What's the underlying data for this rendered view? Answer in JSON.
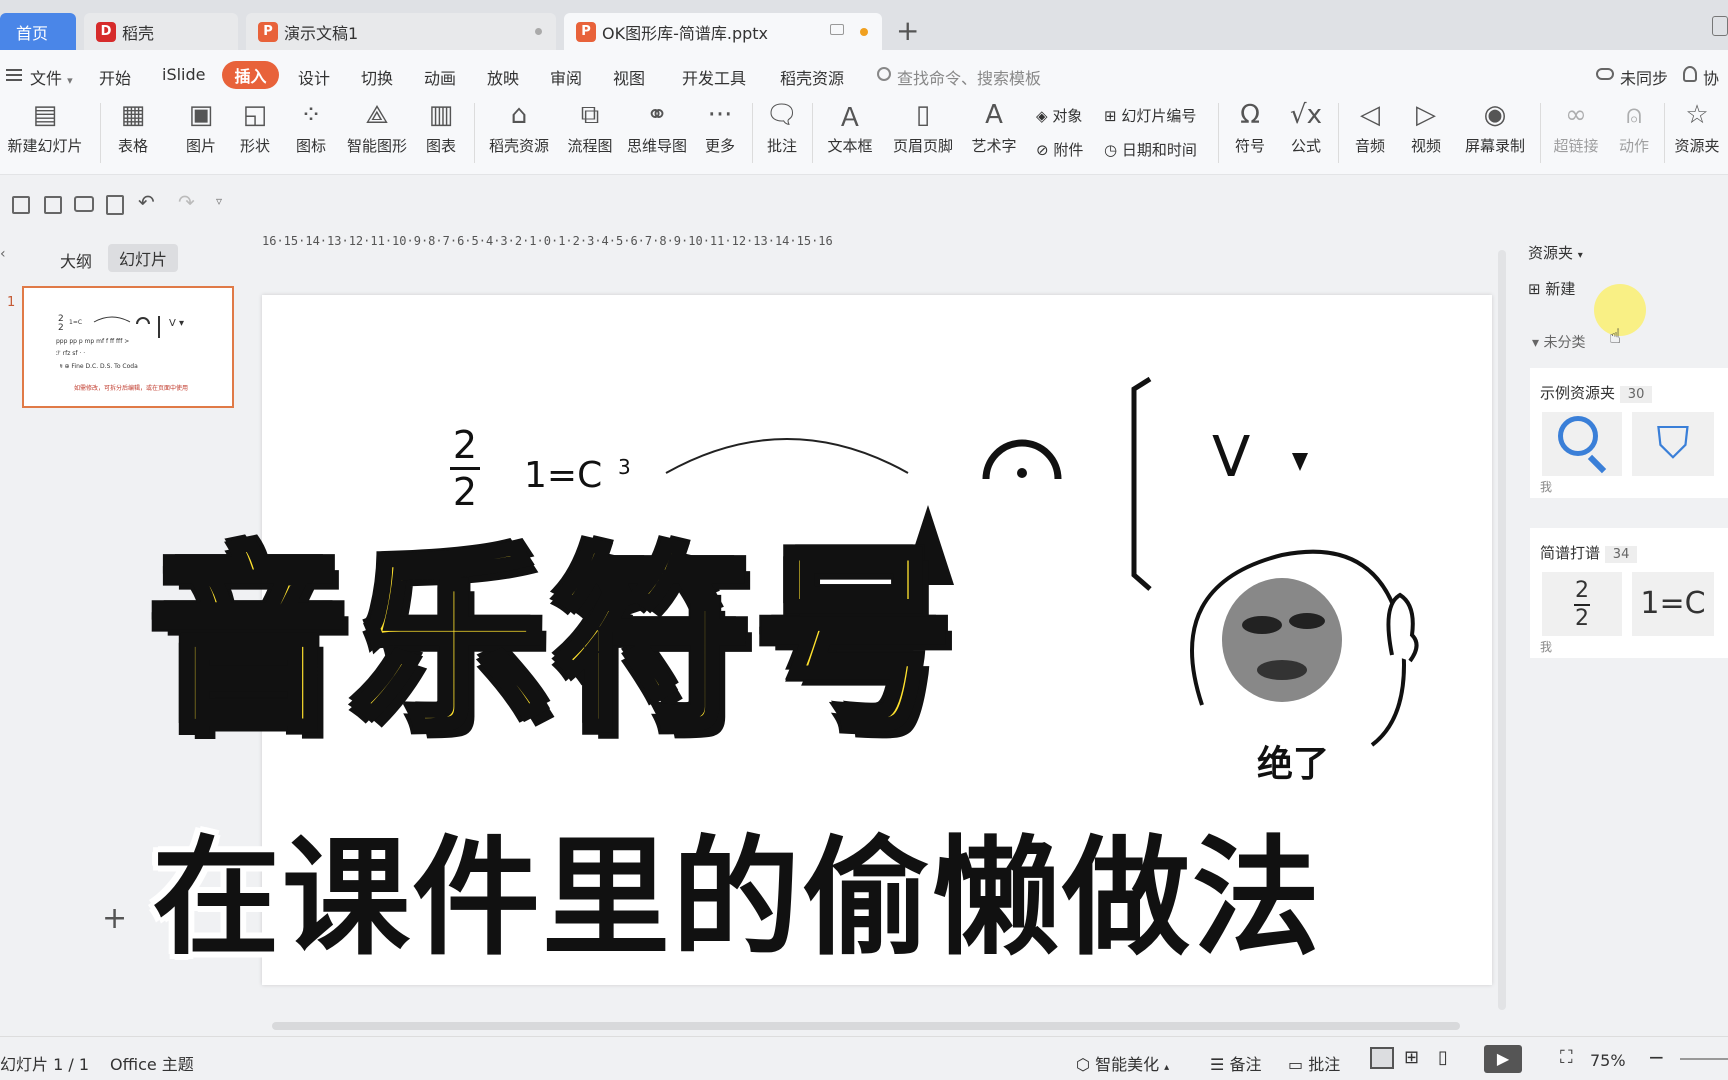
{
  "tabs": {
    "home": "首页",
    "docer": "稻壳",
    "doc1": "演示文稿1",
    "active": "OK图形库-简谱库.pptx"
  },
  "menu": {
    "file": "文件",
    "items": [
      "开始",
      "iSlide",
      "插入",
      "设计",
      "切换",
      "动画",
      "放映",
      "审阅",
      "视图",
      "开发工具",
      "稻壳资源"
    ],
    "active": "插入",
    "search_placeholder": "查找命令、搜索模板",
    "sync": "未同步",
    "collab": "协"
  },
  "ribbon": [
    "新建幻灯片",
    "表格",
    "图片",
    "形状",
    "图标",
    "智能图形",
    "图表",
    "稻壳资源",
    "流程图",
    "思维导图",
    "更多",
    "批注",
    "文本框",
    "页眉页脚",
    "艺术字",
    "符号",
    "公式",
    "音频",
    "视频",
    "屏幕录制",
    "超链接",
    "动作",
    "资源夹"
  ],
  "ribbon_small": {
    "object": "对象",
    "slide_no": "幻灯片编号",
    "attach": "附件",
    "datetime": "日期和时间"
  },
  "left": {
    "outline": "大纲",
    "slides": "幻灯片",
    "slide_num": "1",
    "add": "+"
  },
  "ruler": "16·15·14·13·12·11·10·9·8·7·6·5·4·3·2·1·0·1·2·3·4·5·6·7·8·9·10·11·12·13·14·15·16",
  "slide": {
    "time_sig_top": "2",
    "time_sig_bottom": "2",
    "key": "1=C",
    "small": "3",
    "bow": "V",
    "title_main": "音乐符号",
    "title_sub": "在课件里的偷懒做法",
    "meme_caption": "绝了"
  },
  "right": {
    "header": "资源夹",
    "new": "新建",
    "uncat": "未分类",
    "folder1": "示例资源夹",
    "folder1_count": "30",
    "me1": "我",
    "folder2": "简谱打谱",
    "folder2_count": "34",
    "me2": "我",
    "frac_top": "2",
    "frac_bot": "2",
    "key": "1=C"
  },
  "status": {
    "slide_info": "幻灯片 1 / 1",
    "theme": "Office 主题",
    "beautify": "智能美化",
    "notes": "备注",
    "comment": "批注",
    "zoom": "75%"
  }
}
